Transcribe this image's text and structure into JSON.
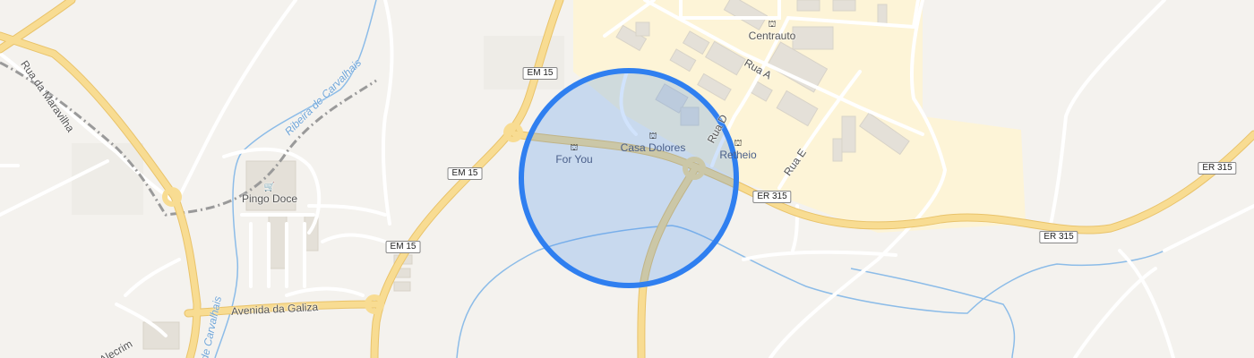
{
  "map": {
    "selection_circle_color": "#2f7ff0",
    "selection_fill_color": "#2f7ff0",
    "urban_area_color": "#fdf4d7",
    "main_road_color": "#f6d68a",
    "water_color": "#8cbce8",
    "road_labels": {
      "em15_a": "EM 15",
      "em15_b": "EM 15",
      "em15_c": "EM 15",
      "er315_a": "ER 315",
      "er315_b": "ER 315",
      "er315_c": "ER 315"
    },
    "street_labels": {
      "rua_a": "Rua A",
      "rua_d": "Rua D",
      "rua_e": "Rua E",
      "rua_maravilha": "Rua da Maravilha",
      "avenida_galiza": "Avenida da Galiza",
      "alecrim": "Alecrim",
      "ribeira_1": "Ribeira de Carvalhais",
      "ribeira_2": "de Carvalhais"
    },
    "pois": {
      "centrauto": "Centrauto",
      "pingo_doce": "Pingo Doce",
      "for_you": "For You",
      "casa_dolores": "Casa Dolores",
      "retheio": "Retheio"
    },
    "icons": {
      "shop": "shopping-bag-icon",
      "cart": "shopping-cart-icon"
    }
  }
}
